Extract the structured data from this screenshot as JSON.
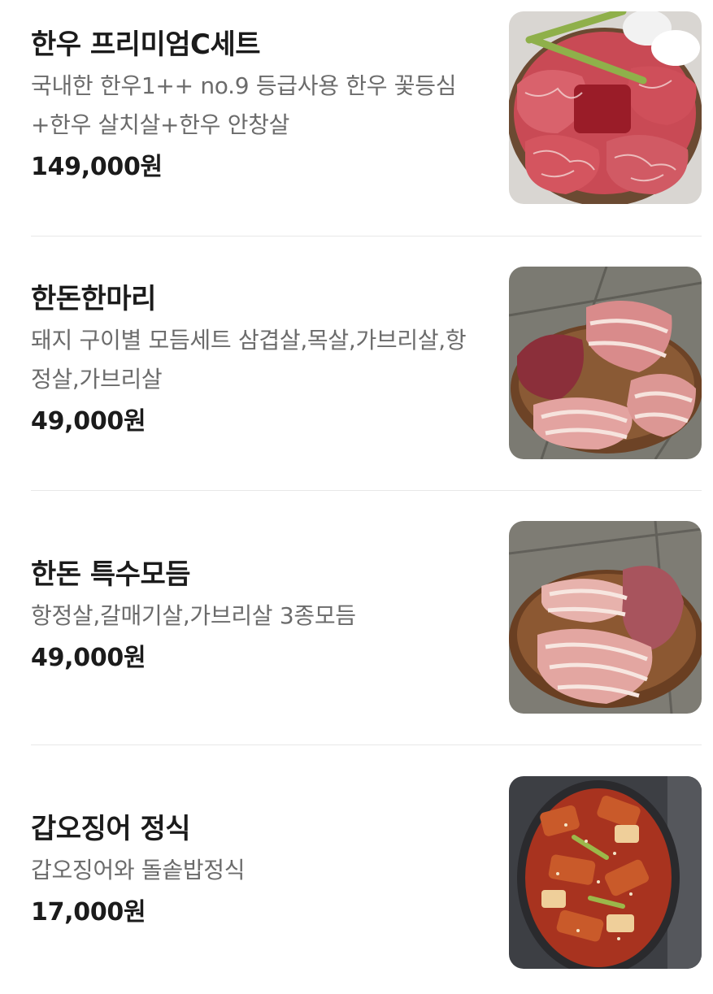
{
  "menu": {
    "items": [
      {
        "name": "한우 프리미엄C세트",
        "description": "국내한 한우1++ no.9 등급사용 한우 꽃등심+한우 살치살+한우 안창살",
        "price": "149,000원",
        "image": "hanwoo-premium-set-photo"
      },
      {
        "name": "한돈한마리",
        "description": "돼지 구이별 모듬세트 삼겹살,목살,가브리살,항정살,가브리살",
        "price": "49,000원",
        "image": "handon-whole-pig-photo"
      },
      {
        "name": "한돈 특수모듬",
        "description": "항정살,갈매기살,가브리살 3종모듬",
        "price": "49,000원",
        "image": "handon-special-platter-photo"
      },
      {
        "name": "갑오징어 정식",
        "description": "갑오징어와 돌솥밥정식",
        "price": "17,000원",
        "image": "cuttlefish-set-photo"
      }
    ]
  },
  "colors": {
    "text_primary": "#1b1b1b",
    "text_secondary": "#6b6b6b",
    "divider": "#e8e8e8",
    "background": "#ffffff"
  }
}
